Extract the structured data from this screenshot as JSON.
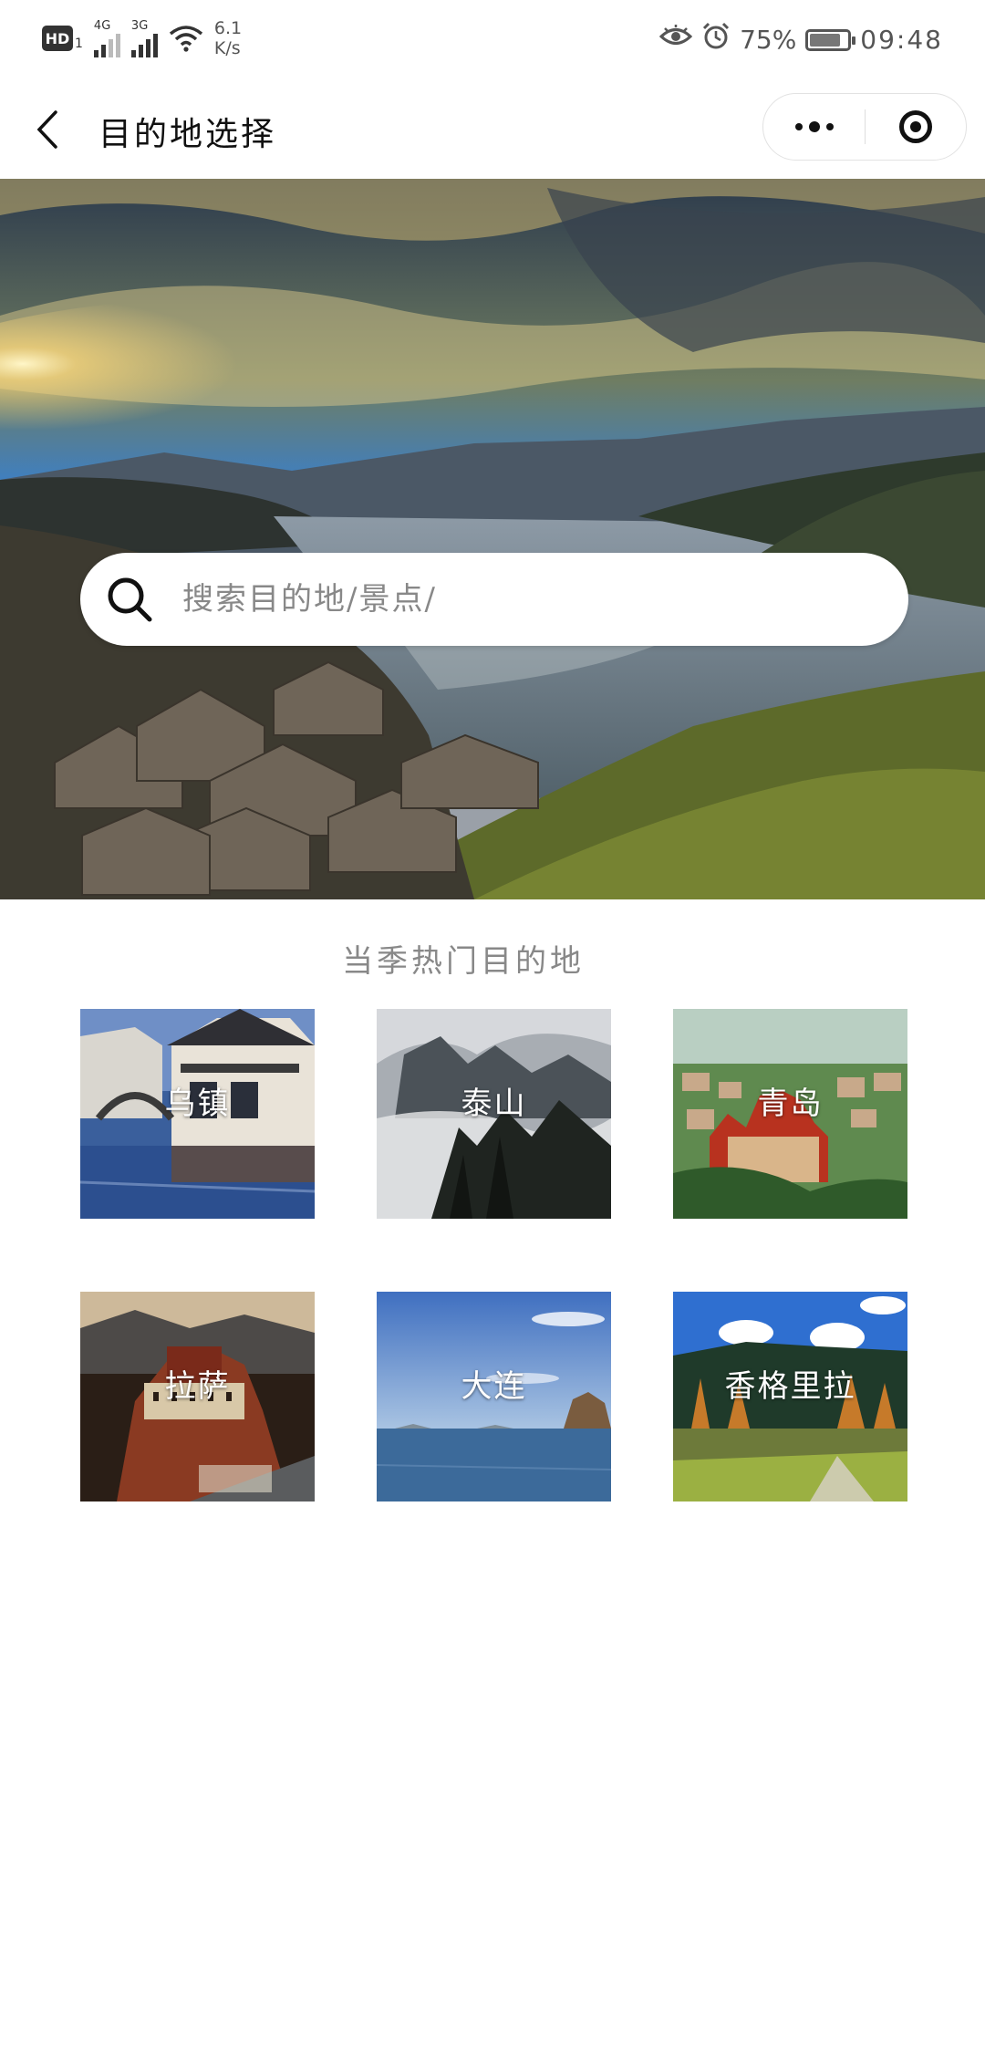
{
  "status_bar": {
    "hd_label": "HD",
    "hd_sub": "1",
    "signal_1_label": "4G",
    "signal_2_label": "3G",
    "net_speed_value": "6.1",
    "net_speed_unit": "K/s",
    "battery_percent": "75%",
    "battery_level": 0.75,
    "time": "09:48"
  },
  "nav": {
    "title": "目的地选择"
  },
  "search": {
    "placeholder": "搜索目的地/景点/"
  },
  "hot": {
    "title": "当季热门目的地",
    "destinations": [
      {
        "name": "乌镇"
      },
      {
        "name": "泰山"
      },
      {
        "name": "青岛"
      },
      {
        "name": "拉萨"
      },
      {
        "name": "大连"
      },
      {
        "name": "香格里拉"
      }
    ]
  }
}
